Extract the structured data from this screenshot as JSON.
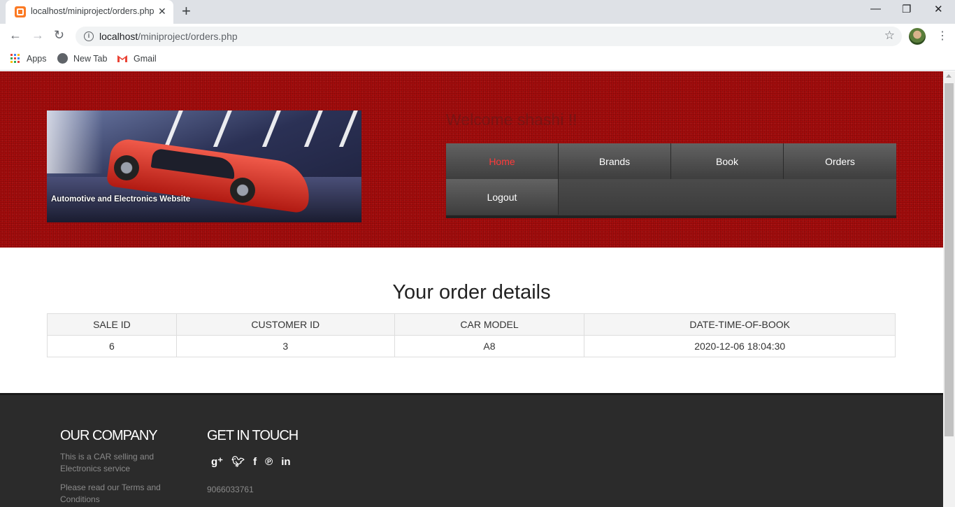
{
  "browser": {
    "tab_title": "localhost/miniproject/orders.php",
    "tab_close": "✕",
    "new_tab": "+",
    "url_host": "localhost",
    "url_path": "/miniproject/orders.php",
    "window_controls": {
      "minimize": "—",
      "maximize": "❐",
      "close": "✕"
    },
    "bookmarks": [
      {
        "label": "Apps",
        "icon": "apps-grid-icon"
      },
      {
        "label": "New Tab",
        "icon": "globe-icon"
      },
      {
        "label": "Gmail",
        "icon": "gmail-icon"
      }
    ]
  },
  "header": {
    "banner_caption": "Automotive and Electronics Website",
    "welcome": "Welcome shashi !!",
    "nav": [
      {
        "label": "Home",
        "active": true
      },
      {
        "label": "Brands"
      },
      {
        "label": "Book"
      },
      {
        "label": "Orders"
      },
      {
        "label": "Logout"
      }
    ],
    "colors": {
      "header_bg": "#a40c0c",
      "nav_active": "#ff3a3a",
      "welcome": "#7a1414"
    }
  },
  "content": {
    "title": "Your order details",
    "table": {
      "columns": [
        "SALE ID",
        "CUSTOMER ID",
        "CAR MODEL",
        "DATE-TIME-OF-BOOK"
      ],
      "rows": [
        [
          "6",
          "3",
          "A8",
          "2020-12-06 18:04:30"
        ]
      ]
    }
  },
  "footer": {
    "company_heading": "OUR COMPANY",
    "company_text": "This is a CAR selling and Electronics service",
    "terms_text": "Please read our Terms and Conditions",
    "contact_heading": "GET IN TOUCH",
    "social": [
      "google-plus-icon",
      "twitter-icon",
      "facebook-icon",
      "pinterest-icon",
      "linkedin-icon"
    ],
    "phone": "9066033761"
  }
}
